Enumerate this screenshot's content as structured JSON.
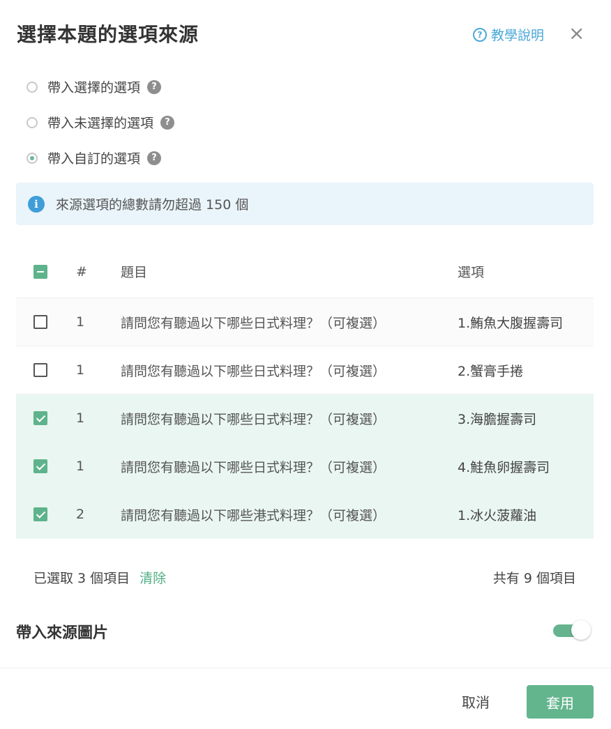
{
  "header": {
    "title": "選擇本題的選項來源",
    "help_link": "教學說明",
    "close_symbol": "×"
  },
  "source_options": [
    {
      "label": "帶入選擇的選項",
      "selected": false
    },
    {
      "label": "帶入未選擇的選項",
      "selected": false
    },
    {
      "label": "帶入自訂的選項",
      "selected": true
    }
  ],
  "notice": {
    "text": "來源選項的總數請勿超過 150 個",
    "icon_glyph": "i"
  },
  "table": {
    "columns": {
      "num": "#",
      "question": "題目",
      "option": "選項"
    },
    "rows": [
      {
        "num": "1",
        "question": "請問您有聽過以下哪些日式料理？（可複選）",
        "option": "1.鮪魚大腹握壽司",
        "checked": false
      },
      {
        "num": "1",
        "question": "請問您有聽過以下哪些日式料理？（可複選）",
        "option": "2.蟹膏手捲",
        "checked": false
      },
      {
        "num": "1",
        "question": "請問您有聽過以下哪些日式料理？（可複選）",
        "option": "3.海膽握壽司",
        "checked": true
      },
      {
        "num": "1",
        "question": "請問您有聽過以下哪些日式料理？（可複選）",
        "option": "4.鮭魚卵握壽司",
        "checked": true
      },
      {
        "num": "2",
        "question": "請問您有聽過以下哪些港式料理？（可複選）",
        "option": "1.冰火菠蘿油",
        "checked": true
      }
    ]
  },
  "selection": {
    "selected_text": "已選取 3 個項目",
    "clear_label": "清除",
    "total_text": "共有 9 個項目"
  },
  "image_setting": {
    "label": "帶入來源圖片",
    "enabled": true
  },
  "footer": {
    "cancel_label": "取消",
    "apply_label": "套用"
  },
  "colors": {
    "accent": "#5fb38c",
    "link": "#4aa8d8",
    "notice_bg": "#eaf4fb",
    "selected_row_bg": "#eaf6f1"
  }
}
